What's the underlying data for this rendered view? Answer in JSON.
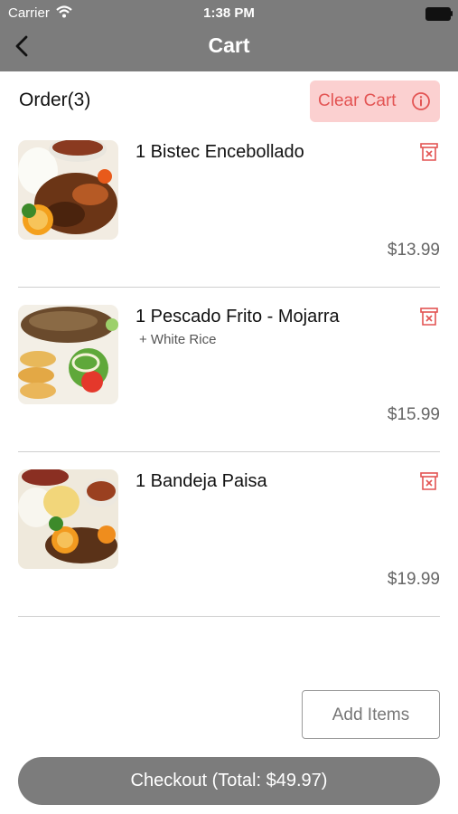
{
  "status_bar": {
    "carrier": "Carrier",
    "time": "1:38 PM"
  },
  "nav": {
    "title": "Cart",
    "back_icon": "chevron-left-icon"
  },
  "order": {
    "label": "Order(3)",
    "clear_label": "Clear Cart",
    "clear_icon": "info-icon",
    "accent_color": "#e35453",
    "clear_bg": "#fbd0d0"
  },
  "items": [
    {
      "name": "1 Bistec Encebollado",
      "modifier": "",
      "price": "$13.99",
      "image": "steak-with-onions-plate"
    },
    {
      "name": "1 Pescado Frito - Mojarra",
      "modifier": "+ White Rice",
      "price": "$15.99",
      "image": "fried-fish-plate"
    },
    {
      "name": "1 Bandeja Paisa",
      "modifier": "",
      "price": "$19.99",
      "image": "bandeja-paisa-plate"
    }
  ],
  "actions": {
    "add_items": "Add Items",
    "checkout": "Checkout (Total: $49.97)"
  },
  "colors": {
    "header": "#7c7c7c",
    "checkout": "#7c7c7c"
  }
}
